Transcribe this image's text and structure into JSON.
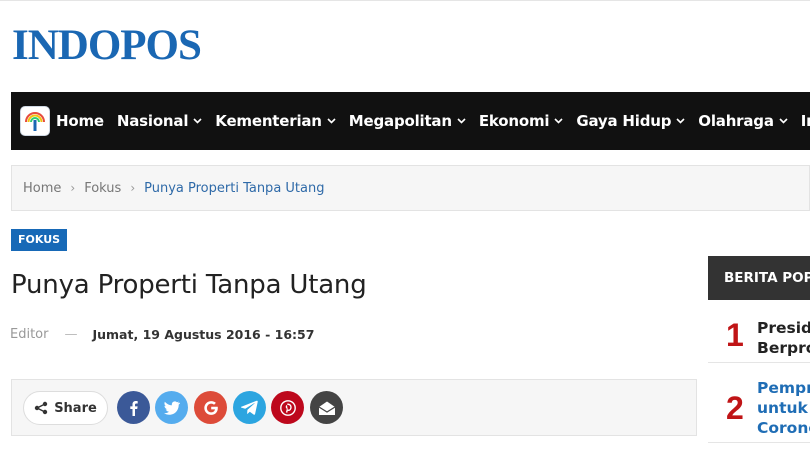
{
  "site": {
    "logo": "INDOPOS"
  },
  "nav": {
    "items": [
      {
        "label": "Home",
        "dropdown": false
      },
      {
        "label": "Nasional",
        "dropdown": true
      },
      {
        "label": "Kementerian",
        "dropdown": true
      },
      {
        "label": "Megapolitan",
        "dropdown": true
      },
      {
        "label": "Ekonomi",
        "dropdown": true
      },
      {
        "label": "Gaya Hidup",
        "dropdown": true
      },
      {
        "label": "Olahraga",
        "dropdown": true
      },
      {
        "label": "Int",
        "dropdown": false
      }
    ]
  },
  "breadcrumb": {
    "home": "Home",
    "section": "Fokus",
    "current": "Punya Properti Tanpa Utang"
  },
  "article": {
    "category": "FOKUS",
    "title": "Punya Properti Tanpa Utang",
    "author": "Editor",
    "separator": "—",
    "date": "Jumat, 19 Agustus 2016 - 16:57"
  },
  "share": {
    "label": "Share",
    "buttons": [
      {
        "name": "facebook",
        "color": "#3b5998"
      },
      {
        "name": "twitter",
        "color": "#55acee"
      },
      {
        "name": "google",
        "color": "#dd4b39"
      },
      {
        "name": "telegram",
        "color": "#2ca5e0"
      },
      {
        "name": "pinterest",
        "color": "#bd081c"
      },
      {
        "name": "email",
        "color": "#444444"
      }
    ]
  },
  "sidebar": {
    "heading": "BERITA POPU",
    "items": [
      {
        "rank": "1",
        "line1": "Preside",
        "line2": "Berpro",
        "color": "#222222"
      },
      {
        "rank": "2",
        "line1": "Pempr",
        "line2": "untuk I",
        "line3": "Corone",
        "color": "#1f6db5"
      }
    ]
  }
}
